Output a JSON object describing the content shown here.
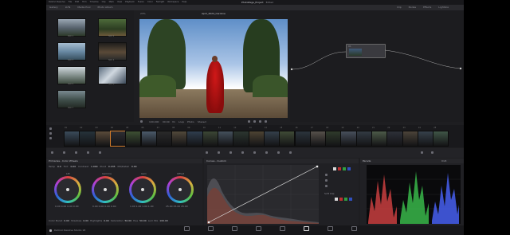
{
  "app": {
    "name": "DaVinci Resolve",
    "version_label": "DaVinci Resolve Studio 18"
  },
  "menubar": {
    "items": [
      "DaVinci Resolve",
      "File",
      "Edit",
      "Trim",
      "Timeline",
      "Clip",
      "Mark",
      "View",
      "Playback",
      "Fusion",
      "Color",
      "Fairlight",
      "Workspace",
      "Help"
    ]
  },
  "titlebar": {
    "project": "PhotoPage_Project",
    "status": "Edited"
  },
  "toolbar": {
    "left": [
      "Gallery",
      "LUTs",
      "Media Pool",
      "Photo Album"
    ],
    "right": [
      "Clip",
      "Nodes",
      "Effects",
      "Lightbox"
    ]
  },
  "viewer": {
    "title": "April_2024_Caroline",
    "zoom": "23%"
  },
  "viewer_controls": {
    "labels": [
      "100.000",
      "00:00",
      "V1",
      "Loop",
      "Photo",
      "Shared"
    ]
  },
  "gallery": {
    "captions": [
      "Still 1",
      "Still 2",
      "Still 3",
      "Still 4",
      "Still 5",
      "Still 6",
      "Still 7"
    ]
  },
  "node": {
    "label": "01"
  },
  "timeline": {
    "clip_labels": [
      "01",
      "02",
      "03",
      "04",
      "05",
      "06",
      "07",
      "08",
      "09",
      "10",
      "11",
      "12",
      "13",
      "14",
      "15",
      "16",
      "17",
      "18",
      "19",
      "20",
      "21",
      "22",
      "23",
      "24",
      "25"
    ]
  },
  "primaries": {
    "title": "Primaries - Color Wheels",
    "params": [
      "Temp",
      "0.0",
      "Tint",
      "0.00",
      "Contrast",
      "1.000",
      "Pivot",
      "0.435",
      "Md/Detail",
      "0.00"
    ],
    "wheels": [
      {
        "name": "Lift",
        "values": "0.00 0.00 0.00 0.00"
      },
      {
        "name": "Gamma",
        "values": "0.00 0.00 0.00 0.00"
      },
      {
        "name": "Gain",
        "values": "1.00 1.00 1.00 1.00"
      },
      {
        "name": "Offset",
        "values": "25.00 25.00 25.00"
      }
    ],
    "footer": [
      "Color Boost",
      "0.00",
      "Shadows",
      "0.00",
      "Highlights",
      "0.00",
      "Saturation",
      "50.00",
      "Hue",
      "50.00",
      "Lum Mix",
      "100.00"
    ]
  },
  "curves": {
    "title": "Curves - Custom",
    "soft_clip": "Soft Clip"
  },
  "scope": {
    "title": "Parade",
    "mode": "RGB"
  },
  "pages": [
    {
      "name": "Media",
      "active": false
    },
    {
      "name": "Photo",
      "active": false
    },
    {
      "name": "Cut",
      "active": false
    },
    {
      "name": "Edit",
      "active": false
    },
    {
      "name": "Fusion",
      "active": false
    },
    {
      "name": "Color",
      "active": true
    },
    {
      "name": "Fairlight",
      "active": false
    },
    {
      "name": "Deliver",
      "active": false
    }
  ]
}
